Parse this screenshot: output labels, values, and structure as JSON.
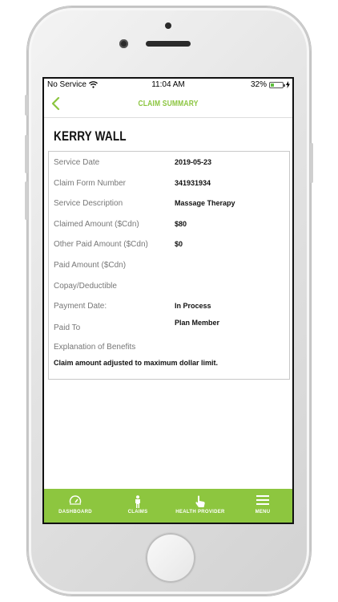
{
  "status_bar": {
    "carrier": "No Service",
    "time": "11:04 AM",
    "battery": "32%",
    "battery_level": 0.32
  },
  "nav": {
    "title": "CLAIM SUMMARY",
    "back_icon": "chevron-left-icon",
    "accent_color": "#8bc53f"
  },
  "member": {
    "name": "KERRY WALL"
  },
  "claim": {
    "rows": [
      {
        "label": "Service Date",
        "value": "2019-05-23"
      },
      {
        "label": "Claim Form Number",
        "value": "341931934"
      },
      {
        "label": "Service Description",
        "value": "Massage Therapy"
      },
      {
        "label": "Claimed Amount ($Cdn)",
        "value": "$80"
      },
      {
        "label": "Other Paid Amount ($Cdn)",
        "value": "$0"
      },
      {
        "label": "Paid Amount ($Cdn)",
        "value": ""
      },
      {
        "label": "Copay/Deductible",
        "value": ""
      },
      {
        "label": "Payment Date:",
        "value": "In Process"
      },
      {
        "label": "Paid To",
        "value": "Plan Member"
      },
      {
        "label": "Explanation of Benefits",
        "value": ""
      }
    ],
    "explanation": "Claim amount adjusted to maximum dollar limit."
  },
  "tabbar": {
    "color": "#8dc63f",
    "tabs": [
      {
        "label": "DASHBOARD",
        "icon": "gauge-icon"
      },
      {
        "label": "CLAIMS",
        "icon": "person-icon"
      },
      {
        "label": "HEALTH PROVIDER",
        "icon": "hand-pointer-icon"
      },
      {
        "label": "MENU",
        "icon": "hamburger-menu-icon"
      }
    ]
  }
}
